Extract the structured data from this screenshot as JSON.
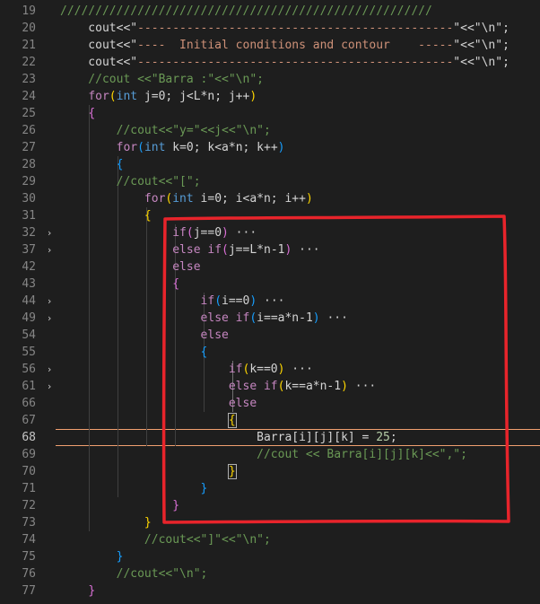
{
  "editor": {
    "active_line": "68",
    "colors": {
      "background": "#1e1e1e",
      "keyword": "#569cd6",
      "control": "#c586c0",
      "string": "#ce9178",
      "number": "#b5cea8",
      "comment": "#6a9955",
      "annotation": "#e8242b",
      "current_line_border": "#f0a070"
    },
    "lines": [
      {
        "n": "19",
        "fold": "",
        "tokens": [
          {
            "t": "/////////////////////////////////////////////////////",
            "c": "cmt"
          }
        ]
      },
      {
        "n": "20",
        "fold": "",
        "tokens": [
          {
            "t": "    cout<<\"",
            "c": "var"
          },
          {
            "t": "---------------------------------------------",
            "c": "str"
          },
          {
            "t": "\"<<\"\\n\";",
            "c": "var"
          }
        ]
      },
      {
        "n": "21",
        "fold": "",
        "tokens": [
          {
            "t": "    cout<<\"",
            "c": "var"
          },
          {
            "t": "----  Initial conditions and contour    -----",
            "c": "str"
          },
          {
            "t": "\"<<\"\\n\";",
            "c": "var"
          }
        ]
      },
      {
        "n": "22",
        "fold": "",
        "tokens": [
          {
            "t": "    cout<<\"",
            "c": "var"
          },
          {
            "t": "---------------------------------------------",
            "c": "str"
          },
          {
            "t": "\"<<\"\\n\";",
            "c": "var"
          }
        ]
      },
      {
        "n": "23",
        "fold": "",
        "tokens": [
          {
            "t": "    //cout <<\"Barra :\"<<\"\\n\";",
            "c": "cmt"
          }
        ]
      },
      {
        "n": "24",
        "fold": "",
        "tokens": [
          {
            "t": "    ",
            "c": "var"
          },
          {
            "t": "for",
            "c": "ctl"
          },
          {
            "t": "(",
            "c": "br1"
          },
          {
            "t": "int",
            "c": "kw"
          },
          {
            "t": " j=0; j<L*n; j++",
            "c": "var"
          },
          {
            "t": ")",
            "c": "br1"
          }
        ]
      },
      {
        "n": "25",
        "fold": "",
        "tokens": [
          {
            "t": "    ",
            "c": "var"
          },
          {
            "t": "{",
            "c": "br2"
          }
        ]
      },
      {
        "n": "26",
        "fold": "",
        "tokens": [
          {
            "t": "        //cout<<\"y=\"<<j<<\"\\n\";",
            "c": "cmt"
          }
        ]
      },
      {
        "n": "27",
        "fold": "",
        "tokens": [
          {
            "t": "        ",
            "c": "var"
          },
          {
            "t": "for",
            "c": "ctl"
          },
          {
            "t": "(",
            "c": "br3"
          },
          {
            "t": "int",
            "c": "kw"
          },
          {
            "t": " k=0; k<a*n; k++",
            "c": "var"
          },
          {
            "t": ")",
            "c": "br3"
          }
        ]
      },
      {
        "n": "28",
        "fold": "",
        "tokens": [
          {
            "t": "        ",
            "c": "var"
          },
          {
            "t": "{",
            "c": "br3"
          }
        ]
      },
      {
        "n": "29",
        "fold": "",
        "tokens": [
          {
            "t": "        //cout<<\"[\";",
            "c": "cmt"
          }
        ]
      },
      {
        "n": "30",
        "fold": "",
        "tokens": [
          {
            "t": "            ",
            "c": "var"
          },
          {
            "t": "for",
            "c": "ctl"
          },
          {
            "t": "(",
            "c": "br1"
          },
          {
            "t": "int",
            "c": "kw"
          },
          {
            "t": " i=0; i<a*n; i++",
            "c": "var"
          },
          {
            "t": ")",
            "c": "br1"
          }
        ]
      },
      {
        "n": "31",
        "fold": "",
        "tokens": [
          {
            "t": "            ",
            "c": "var"
          },
          {
            "t": "{",
            "c": "br1"
          }
        ]
      },
      {
        "n": "32",
        "fold": ">",
        "tokens": [
          {
            "t": "                ",
            "c": "var"
          },
          {
            "t": "if",
            "c": "ctl"
          },
          {
            "t": "(",
            "c": "br2"
          },
          {
            "t": "j==0",
            "c": "var"
          },
          {
            "t": ")",
            "c": "br2"
          },
          {
            "t": " ···",
            "c": "var"
          }
        ]
      },
      {
        "n": "37",
        "fold": ">",
        "tokens": [
          {
            "t": "                ",
            "c": "var"
          },
          {
            "t": "else if",
            "c": "ctl"
          },
          {
            "t": "(",
            "c": "br2"
          },
          {
            "t": "j==L*n-1",
            "c": "var"
          },
          {
            "t": ")",
            "c": "br2"
          },
          {
            "t": " ···",
            "c": "var"
          }
        ]
      },
      {
        "n": "42",
        "fold": "",
        "tokens": [
          {
            "t": "                ",
            "c": "var"
          },
          {
            "t": "else",
            "c": "ctl"
          }
        ]
      },
      {
        "n": "43",
        "fold": "",
        "tokens": [
          {
            "t": "                ",
            "c": "var"
          },
          {
            "t": "{",
            "c": "br2"
          }
        ]
      },
      {
        "n": "44",
        "fold": ">",
        "tokens": [
          {
            "t": "                    ",
            "c": "var"
          },
          {
            "t": "if",
            "c": "ctl"
          },
          {
            "t": "(",
            "c": "br3"
          },
          {
            "t": "i==0",
            "c": "var"
          },
          {
            "t": ")",
            "c": "br3"
          },
          {
            "t": " ···",
            "c": "var"
          }
        ]
      },
      {
        "n": "49",
        "fold": ">",
        "tokens": [
          {
            "t": "                    ",
            "c": "var"
          },
          {
            "t": "else if",
            "c": "ctl"
          },
          {
            "t": "(",
            "c": "br3"
          },
          {
            "t": "i==a*n-1",
            "c": "var"
          },
          {
            "t": ")",
            "c": "br3"
          },
          {
            "t": " ···",
            "c": "var"
          }
        ]
      },
      {
        "n": "54",
        "fold": "",
        "tokens": [
          {
            "t": "                    ",
            "c": "var"
          },
          {
            "t": "else",
            "c": "ctl"
          }
        ]
      },
      {
        "n": "55",
        "fold": "",
        "tokens": [
          {
            "t": "                    ",
            "c": "var"
          },
          {
            "t": "{",
            "c": "br3"
          }
        ]
      },
      {
        "n": "56",
        "fold": ">",
        "tokens": [
          {
            "t": "                        ",
            "c": "var"
          },
          {
            "t": "if",
            "c": "ctl"
          },
          {
            "t": "(",
            "c": "br1"
          },
          {
            "t": "k==0",
            "c": "var"
          },
          {
            "t": ")",
            "c": "br1"
          },
          {
            "t": " ···",
            "c": "var"
          }
        ]
      },
      {
        "n": "61",
        "fold": ">",
        "tokens": [
          {
            "t": "                        ",
            "c": "var"
          },
          {
            "t": "else if",
            "c": "ctl"
          },
          {
            "t": "(",
            "c": "br1"
          },
          {
            "t": "k==a*n-1",
            "c": "var"
          },
          {
            "t": ")",
            "c": "br1"
          },
          {
            "t": " ···",
            "c": "var"
          }
        ]
      },
      {
        "n": "66",
        "fold": "",
        "tokens": [
          {
            "t": "                        ",
            "c": "var"
          },
          {
            "t": "else",
            "c": "ctl"
          }
        ]
      },
      {
        "n": "67",
        "fold": "",
        "tokens": [
          {
            "t": "                        ",
            "c": "var"
          },
          {
            "t": "{",
            "c": "br1"
          }
        ]
      },
      {
        "n": "68",
        "fold": "",
        "tokens": [
          {
            "t": "                            Barra[i][j][k] = ",
            "c": "var"
          },
          {
            "t": "25",
            "c": "num"
          },
          {
            "t": ";",
            "c": "var"
          }
        ]
      },
      {
        "n": "69",
        "fold": "",
        "tokens": [
          {
            "t": "                            //cout << Barra[i][j][k]<<\",\";",
            "c": "cmt"
          }
        ]
      },
      {
        "n": "70",
        "fold": "",
        "tokens": [
          {
            "t": "                        ",
            "c": "var"
          },
          {
            "t": "}",
            "c": "br1"
          }
        ]
      },
      {
        "n": "71",
        "fold": "",
        "tokens": [
          {
            "t": "                    ",
            "c": "var"
          },
          {
            "t": "}",
            "c": "br3"
          }
        ]
      },
      {
        "n": "72",
        "fold": "",
        "tokens": [
          {
            "t": "                ",
            "c": "var"
          },
          {
            "t": "}",
            "c": "br2"
          }
        ]
      },
      {
        "n": "73",
        "fold": "",
        "tokens": [
          {
            "t": "            ",
            "c": "var"
          },
          {
            "t": "}",
            "c": "br1"
          }
        ]
      },
      {
        "n": "74",
        "fold": "",
        "tokens": [
          {
            "t": "            //cout<<\"]\"<<\"\\n\";",
            "c": "cmt"
          }
        ]
      },
      {
        "n": "75",
        "fold": "",
        "tokens": [
          {
            "t": "        ",
            "c": "var"
          },
          {
            "t": "}",
            "c": "br3"
          }
        ]
      },
      {
        "n": "76",
        "fold": "",
        "tokens": [
          {
            "t": "        //cout<<\"\\n\";",
            "c": "cmt"
          }
        ]
      },
      {
        "n": "77",
        "fold": "",
        "tokens": [
          {
            "t": "    ",
            "c": "var"
          },
          {
            "t": "}",
            "c": "br2"
          }
        ]
      }
    ]
  }
}
